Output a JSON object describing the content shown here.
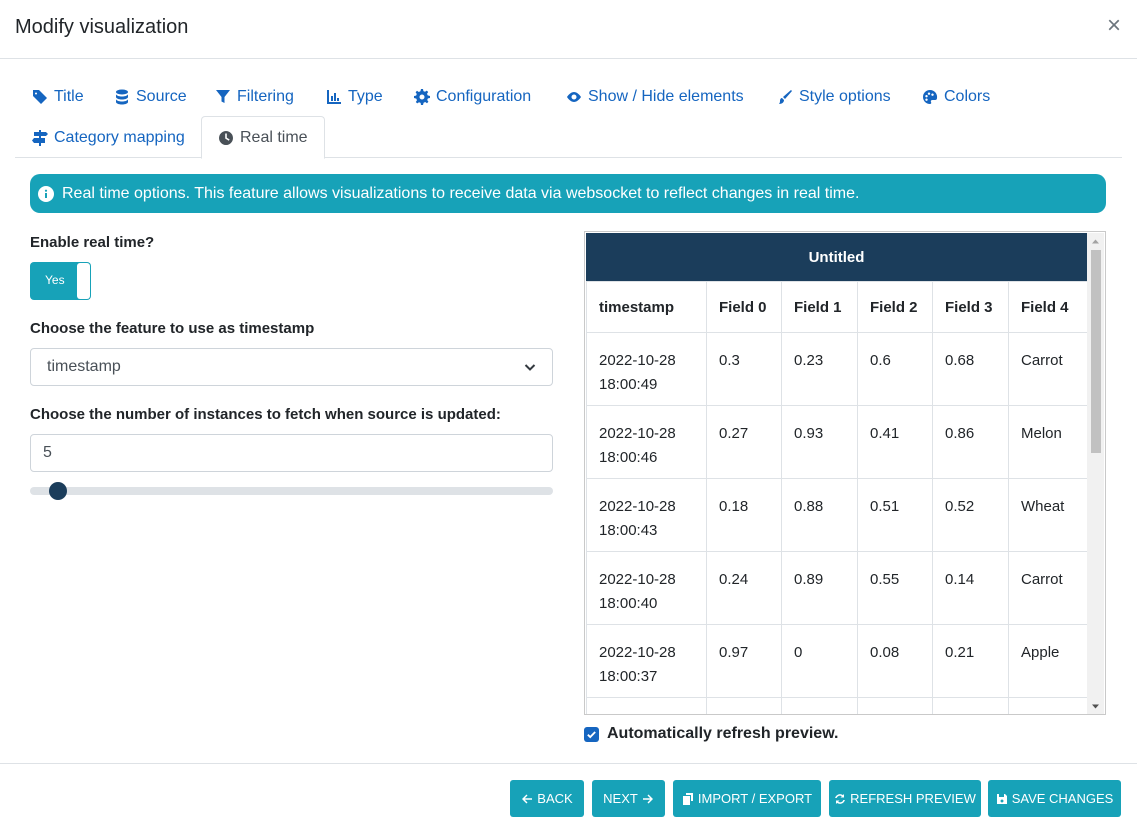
{
  "modal": {
    "title": "Modify visualization",
    "close": "×"
  },
  "tabs": [
    {
      "label": "Title",
      "icon": "tag-icon"
    },
    {
      "label": "Source",
      "icon": "database-icon"
    },
    {
      "label": "Filtering",
      "icon": "filter-icon"
    },
    {
      "label": "Type",
      "icon": "chart-bar-icon"
    },
    {
      "label": "Configuration",
      "icon": "gear-icon"
    },
    {
      "label": "Show / Hide elements",
      "icon": "eye-icon"
    },
    {
      "label": "Style options",
      "icon": "brush-icon"
    },
    {
      "label": "Colors",
      "icon": "palette-icon"
    },
    {
      "label": "Category mapping",
      "icon": "signs-icon"
    },
    {
      "label": "Real time",
      "icon": "clock-icon"
    }
  ],
  "alert": {
    "text": "Real time options. This feature allows visualizations to receive data via websocket to reflect changes in real time.",
    "icon": "info-circle-icon"
  },
  "form": {
    "enable_label": "Enable real time?",
    "toggle_label": "Yes",
    "timestamp_label": "Choose the feature to use as timestamp",
    "timestamp_value": "timestamp",
    "instances_label": "Choose the number of instances to fetch when source is updated:",
    "instances_value": "5",
    "slider_fraction": 0.05
  },
  "preview": {
    "title": "Untitled",
    "columns": [
      "timestamp",
      "Field 0",
      "Field 1",
      "Field 2",
      "Field 3",
      "Field 4"
    ],
    "rows": [
      [
        "2022-10-28\n18:00:49",
        "0.3",
        "0.23",
        "0.6",
        "0.68",
        "Carrot"
      ],
      [
        "2022-10-28\n18:00:46",
        "0.27",
        "0.93",
        "0.41",
        "0.86",
        "Melon"
      ],
      [
        "2022-10-28\n18:00:43",
        "0.18",
        "0.88",
        "0.51",
        "0.52",
        "Wheat"
      ],
      [
        "2022-10-28\n18:00:40",
        "0.24",
        "0.89",
        "0.55",
        "0.14",
        "Carrot"
      ],
      [
        "2022-10-28\n18:00:37",
        "0.97",
        "0",
        "0.08",
        "0.21",
        "Apple"
      ],
      [
        "",
        "",
        "",
        "",
        "",
        ""
      ]
    ]
  },
  "auto_refresh": {
    "label": "Automatically refresh preview.",
    "checked": true
  },
  "buttons": {
    "back": "BACK",
    "next": "NEXT",
    "import_export": "IMPORT / EXPORT",
    "refresh": "REFRESH PREVIEW",
    "save": "SAVE CHANGES"
  },
  "colors": {
    "accent": "#17a2b8",
    "header": "#1b3d5b",
    "link": "#1565c0"
  }
}
